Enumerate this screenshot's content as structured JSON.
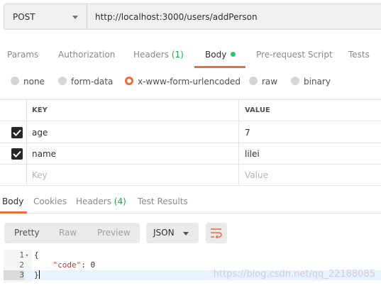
{
  "request": {
    "method": "POST",
    "url": "http://localhost:3000/users/addPerson"
  },
  "request_tabs": [
    {
      "label": "Params"
    },
    {
      "label": "Authorization"
    },
    {
      "label": "Headers",
      "count": "(1)"
    },
    {
      "label": "Body"
    },
    {
      "label": "Pre-request Script"
    },
    {
      "label": "Tests"
    }
  ],
  "body_types": [
    {
      "label": "none"
    },
    {
      "label": "form-data"
    },
    {
      "label": "x-www-form-urlencoded",
      "selected": true
    },
    {
      "label": "raw"
    },
    {
      "label": "binary"
    }
  ],
  "params_table": {
    "key_header": "KEY",
    "value_header": "VALUE",
    "rows": [
      {
        "key": "age",
        "value": "7",
        "checked": true
      },
      {
        "key": "name",
        "value": "lilei",
        "checked": true
      }
    ],
    "key_placeholder": "Key",
    "value_placeholder": "Value"
  },
  "response_tabs": [
    {
      "label": "Body"
    },
    {
      "label": "Cookies"
    },
    {
      "label": "Headers",
      "count": "(4)"
    },
    {
      "label": "Test Results"
    }
  ],
  "response_toolbar": {
    "formats": [
      "Pretty",
      "Raw",
      "Preview"
    ],
    "language": "JSON"
  },
  "response_body": {
    "line_numbers": [
      "1",
      "2",
      "3"
    ],
    "fold_marker": "▾",
    "line1": "{",
    "line2_key": "\"code\"",
    "line2_rest": ": 0",
    "line3": "}"
  },
  "watermark": "https://blog.csdn.net/qq_22188085",
  "colors": {
    "accent": "#f26b3a",
    "active_dot": "#28c76f",
    "count_green": "#28a745"
  },
  "icons": {
    "method_dropdown": "chevron-down-icon",
    "checkbox": "check-icon",
    "wrap": "wrap-lines-icon"
  }
}
